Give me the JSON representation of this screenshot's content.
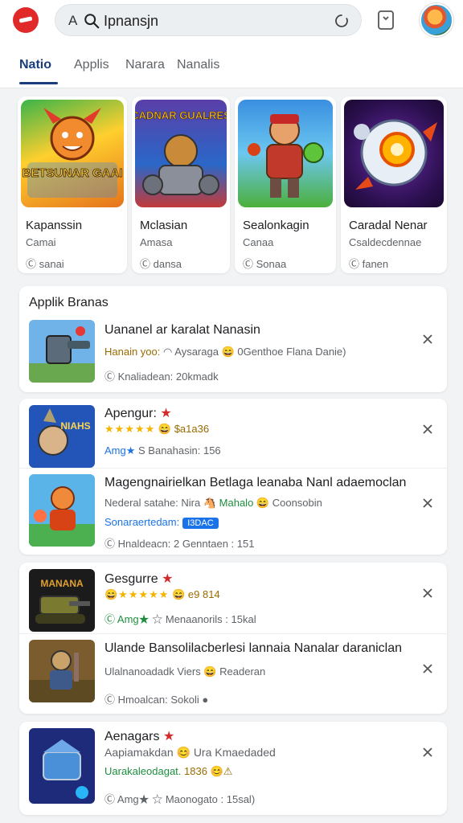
{
  "search": {
    "prefix": "A",
    "value": "Ipnansjn"
  },
  "tabs": [
    "Natio",
    "Applis",
    "Narara",
    "Nanalis"
  ],
  "featured": [
    {
      "art_text": "BETSUNAR GAAI",
      "title": "Kapanssin",
      "sub": "Camai",
      "meta": "Ⓒ sanai"
    },
    {
      "art_text": "SCADNAR GUALRESS",
      "title": "Mclasian",
      "sub": "Amasa",
      "meta": "Ⓒ dansa"
    },
    {
      "title": "Sealonkagin",
      "sub": "Canaa",
      "meta": "Ⓒ Sonaa"
    },
    {
      "title": "Caradal Nenar",
      "sub": "Csaldecdennae",
      "meta": "Ⓒ fanen"
    }
  ],
  "section1": {
    "title": "Applik Branas",
    "item": {
      "line1": "Uananel ar karalat Nanasin",
      "line2_a": "Hanain yoo:",
      "line2_b": "◠ Aysaraga 😄 0Genthoe Flana Danie)",
      "line3": "Ⓒ Knaliadean:   20kmadk"
    }
  },
  "section2": {
    "items": [
      {
        "art_text": "NIAHS",
        "line1": "Apengur:",
        "stars": "★★★★★",
        "line2_b": "😄 $a1a36",
        "badge": "Amg★",
        "line3": "S  Banahasin: 156"
      },
      {
        "line1": "Magengnairielkan Betlaga leanaba Nanl adaemoclan",
        "line2": "Nederal satahe:  Nira",
        "line2_green": "🐴 Mahalo",
        "line2_c": "😄 Coonsobin",
        "line3_a": "Sonaraertedam:",
        "pill": "I3DAC",
        "line3_b": "Ⓒ Hnaldeacn:   2  Genntaen : 151"
      }
    ]
  },
  "section3": {
    "items": [
      {
        "art_text": "MANANA",
        "line1": "Gesgurre",
        "stars": "😄★★★★★",
        "line2_b": "😄 e9 814",
        "badge": "Ⓒ Amg★",
        "line3": "☆  Menaanorils : 15kal"
      },
      {
        "line1": "Ulande Bansolilacberlesi lannaia Nanalar daraniclan",
        "line2_green": "Ulalnanoadadk  Viers 😄 Readeran",
        "line3": "Ⓒ Hmoalcan:   Sokoli ●"
      }
    ]
  },
  "section4": {
    "item": {
      "line1": "Aenagars",
      "line2": "Aapiamakdan 😊 Ura Kmaedaded",
      "line3_green": "Uarakaleodagat.",
      "line3_brown": "1836 😊⚠",
      "line4": "Ⓒ Amg★  ☆  Maonogato : 15sal)"
    }
  },
  "colors": {
    "accent": "#1a3d7c",
    "brand_red": "#e02a2a",
    "green": "#1e8e3e"
  }
}
